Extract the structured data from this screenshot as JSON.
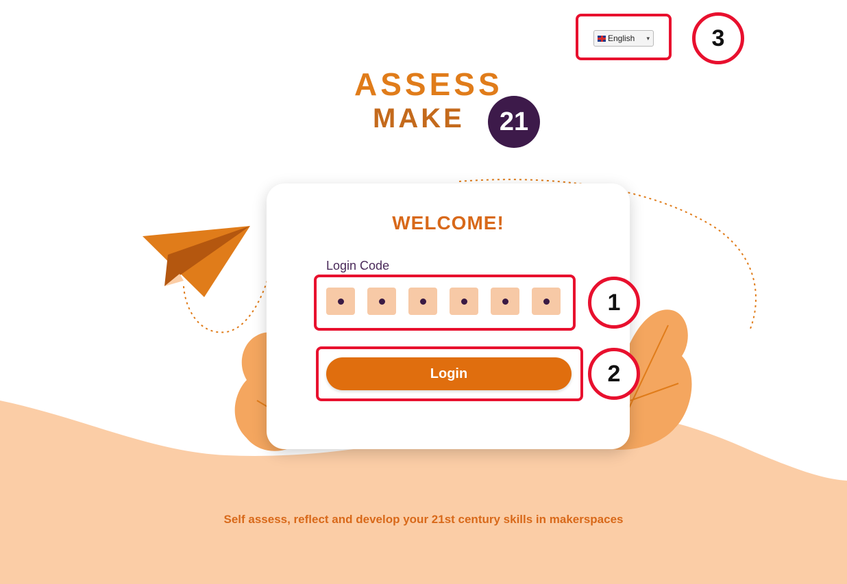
{
  "language_selector": {
    "value": "English",
    "flag_icon": "uk-flag-icon",
    "chevron_icon": "chevron-down-icon"
  },
  "logo": {
    "line1": "ASSESS",
    "line2": "MAKE",
    "badge": "21"
  },
  "card": {
    "title": "WELCOME!",
    "login_code_label": "Login Code",
    "code_slot_count": 6,
    "login_button": "Login"
  },
  "annotations": {
    "one": "1",
    "two": "2",
    "three": "3"
  },
  "tagline": "Self assess, reflect and develop your 21st century skills in makerspaces",
  "colors": {
    "accent": "#e06e0e",
    "title": "#d8691a",
    "code_box": "#f7c9a6",
    "highlight": "#e8102e",
    "ground": "#fbcda6",
    "leaf": "#f4a65f",
    "logo_badge": "#3d1a4a"
  }
}
